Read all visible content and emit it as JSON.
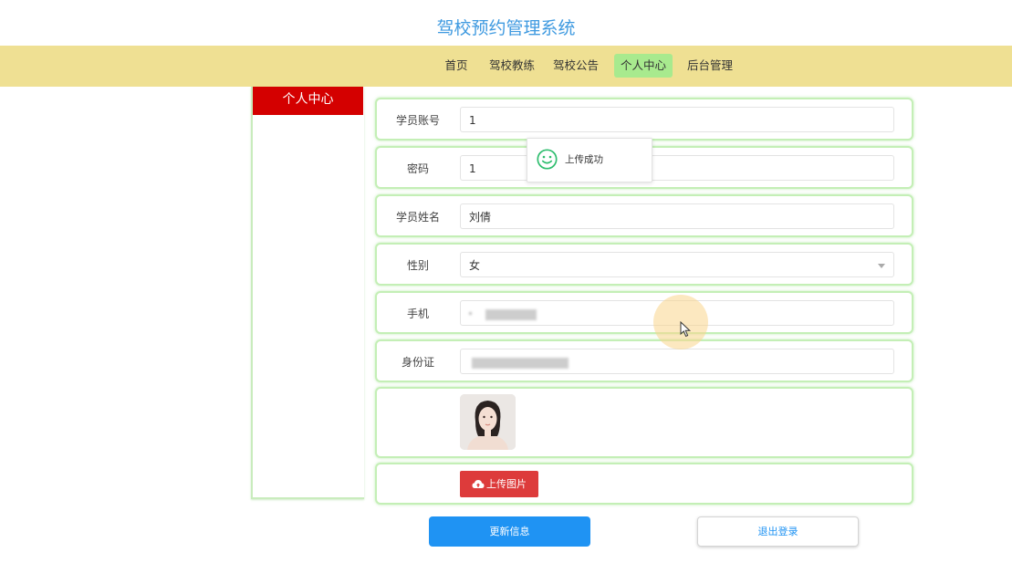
{
  "site": {
    "title": "驾校预约管理系统"
  },
  "nav": {
    "items": [
      {
        "label": "首页"
      },
      {
        "label": "驾校教练"
      },
      {
        "label": "驾校公告"
      },
      {
        "label": "个人中心",
        "active": true
      },
      {
        "label": "后台管理"
      }
    ]
  },
  "sidebar": {
    "title": "个人中心"
  },
  "form": {
    "account": {
      "label": "学员账号",
      "value": "1"
    },
    "password": {
      "label": "密码",
      "value": "1"
    },
    "name": {
      "label": "学员姓名",
      "value": "刘倩"
    },
    "gender": {
      "label": "性别",
      "value": "女"
    },
    "phone": {
      "label": "手机",
      "value": ""
    },
    "id_card": {
      "label": "身份证",
      "value": ""
    },
    "upload_button": "上传图片"
  },
  "actions": {
    "update": "更新信息",
    "logout": "退出登录"
  },
  "toast": {
    "message": "上传成功",
    "icon": "smile-icon"
  },
  "colors": {
    "title": "#3f9ae0",
    "nav_bg": "#efe093",
    "nav_active": "#a8ea8e",
    "sidebar_head": "#d40000",
    "row_border": "#c4efb6",
    "upload_button": "#dd3b3b",
    "primary": "#1f93f3",
    "toast_icon": "#2ebd6e"
  }
}
